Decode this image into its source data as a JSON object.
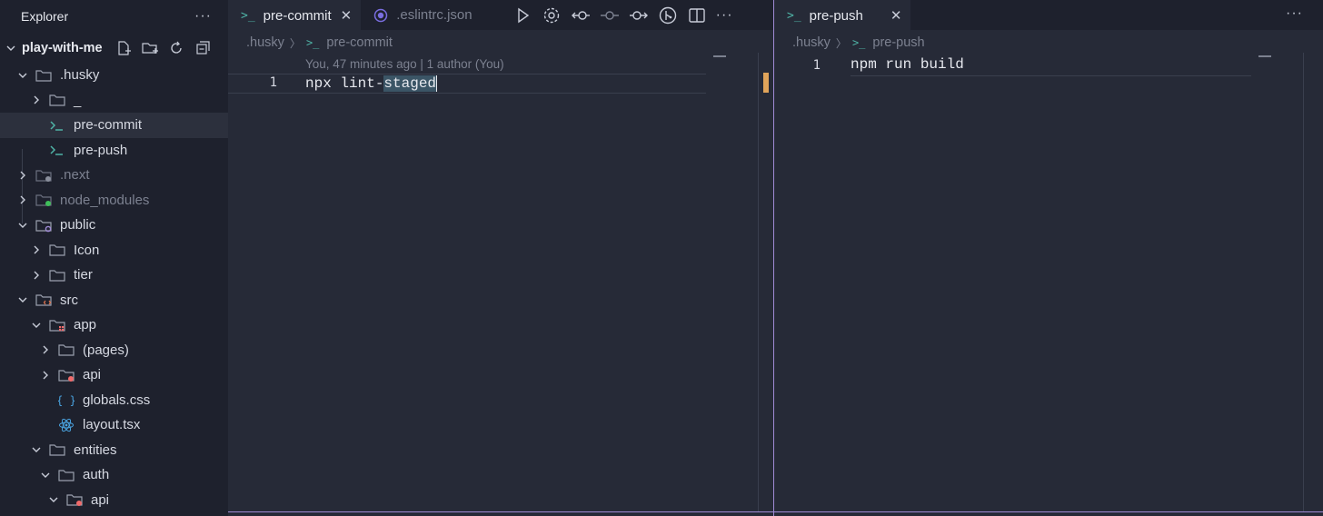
{
  "explorer": {
    "title": "Explorer",
    "more": "···",
    "root": "play-with-me"
  },
  "tree": [
    {
      "label": ".husky",
      "depth": 1,
      "expanded": true,
      "icon": "folder"
    },
    {
      "label": "_",
      "depth": 2,
      "expanded": false,
      "icon": "folder"
    },
    {
      "label": "pre-commit",
      "depth": 2,
      "icon": "terminal",
      "selected": true
    },
    {
      "label": "pre-push",
      "depth": 2,
      "icon": "terminal"
    },
    {
      "label": ".next",
      "depth": 1,
      "expanded": false,
      "icon": "folder-dot-grey",
      "dim": true
    },
    {
      "label": "node_modules",
      "depth": 1,
      "expanded": false,
      "icon": "folder-dot-green",
      "dim": true
    },
    {
      "label": "public",
      "depth": 1,
      "expanded": true,
      "icon": "folder-dot-purple"
    },
    {
      "label": "Icon",
      "depth": 2,
      "expanded": false,
      "icon": "folder"
    },
    {
      "label": "tier",
      "depth": 2,
      "expanded": false,
      "icon": "folder"
    },
    {
      "label": "src",
      "depth": 1,
      "expanded": true,
      "icon": "folder-code"
    },
    {
      "label": "app",
      "depth": 2,
      "expanded": true,
      "icon": "folder-app"
    },
    {
      "label": "(pages)",
      "depth": 3,
      "expanded": false,
      "icon": "folder"
    },
    {
      "label": "api",
      "depth": 3,
      "expanded": false,
      "icon": "folder-dot-red"
    },
    {
      "label": "globals.css",
      "depth": 3,
      "icon": "css"
    },
    {
      "label": "layout.tsx",
      "depth": 3,
      "icon": "react"
    },
    {
      "label": "entities",
      "depth": 2,
      "expanded": true,
      "icon": "folder"
    },
    {
      "label": "auth",
      "depth": 3,
      "expanded": true,
      "icon": "folder"
    },
    {
      "label": "api",
      "depth": 4,
      "expanded": true,
      "icon": "folder-dot-red"
    }
  ],
  "editor_left": {
    "tabs": [
      {
        "label": "pre-commit",
        "active": true
      },
      {
        "label": ".eslintrc.json",
        "active": false
      }
    ],
    "breadcrumb": [
      ".husky",
      "pre-commit"
    ],
    "blame": "You, 47 minutes ago | 1 author (You)",
    "line_number": "1",
    "code_plain": "npx lint-",
    "code_selected": "staged"
  },
  "editor_right": {
    "tab": "pre-push",
    "breadcrumb": [
      ".husky",
      "pre-push"
    ],
    "line_number": "1",
    "code": "npm run build"
  },
  "colors": {
    "accent": "#a08bd6",
    "terminal_icon": "#4fb3a6",
    "sidebar_bg": "#1e212d",
    "editor_bg": "#262a37"
  }
}
